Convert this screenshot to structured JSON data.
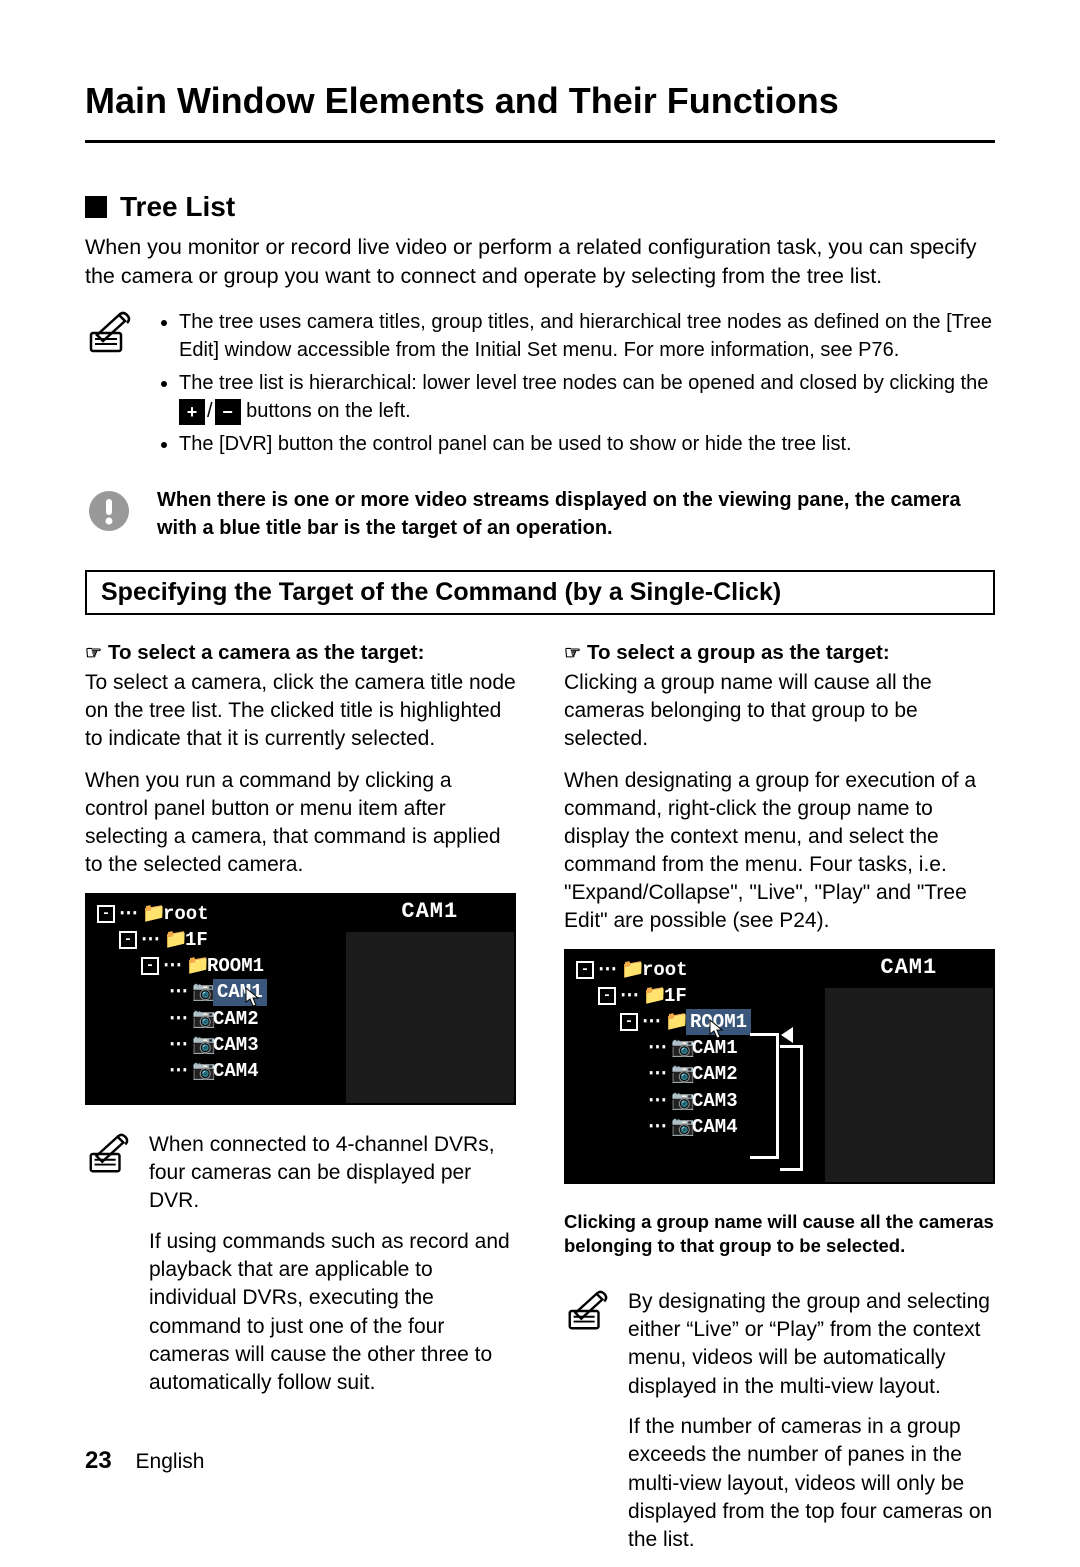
{
  "title": "Main Window Elements and Their Functions",
  "section": "Tree List",
  "intro": "When you monitor or record live video or perform a related configuration task, you can specify the camera or group you want to connect and operate by selecting from the tree list.",
  "bullets": [
    "The tree uses camera titles, group titles, and hierarchical tree nodes as defined on the [Tree Edit] window accessible from the Initial Set menu. For more information, see P76.",
    "The tree list is hierarchical: lower level tree nodes can be opened and closed by clicking the  /  buttons on the left.",
    "The [DVR] button the control panel can be used to show or hide the tree list."
  ],
  "bullet2_pre": "The tree list is hierarchical: lower level tree nodes can be opened and closed by clicking the",
  "bullet2_post": "buttons on the left.",
  "warning": "When there is one or more video streams displayed on the viewing pane, the camera with a blue title bar is the target of an operation.",
  "subhead": "Specifying the Target of the Command (by a Single-Click)",
  "left": {
    "lead": "To select a camera as the target:",
    "p1": "To select a camera, click the camera title node on the tree list. The clicked title is highlighted to indicate that it is currently selected.",
    "p2": "When you run a command by clicking a control panel button or menu item after selecting a camera, that command is applied to the selected camera.",
    "note_p1": "When connected to 4-channel DVRs, four cameras can be displayed per DVR.",
    "note_p2": "If using commands such as record and playback that are applicable to individual DVRs, executing the command to just one of the four cameras will cause the other three to automatically follow suit."
  },
  "right": {
    "lead": "To select a group as the target:",
    "p1": "Clicking a group name will cause all the cameras belonging to that group to be selected.",
    "p2": "When designating a group for execution of a command, right-click the group name to display the context menu, and select the command from the menu. Four tasks, i.e. \"Expand/Collapse\", \"Live\", \"Play\" and \"Tree Edit\" are possible (see P24).",
    "caption": "Clicking a group name will cause all the cameras belonging to that group to be selected.",
    "note_p1": "By designating the group and selecting either “Live” or “Play” from the context menu, videos will be automatically displayed in the multi-view layout.",
    "note_p2": "If the number of cameras in a group exceeds the number of panes in the multi-view layout, videos will only be displayed from the top four cameras on the list."
  },
  "tree": {
    "root": "root",
    "f1": "1F",
    "room": "ROOM1",
    "cams": [
      "CAM1",
      "CAM2",
      "CAM3",
      "CAM4"
    ],
    "preview_label": "CAM1"
  },
  "page_number": "23",
  "language": "English"
}
